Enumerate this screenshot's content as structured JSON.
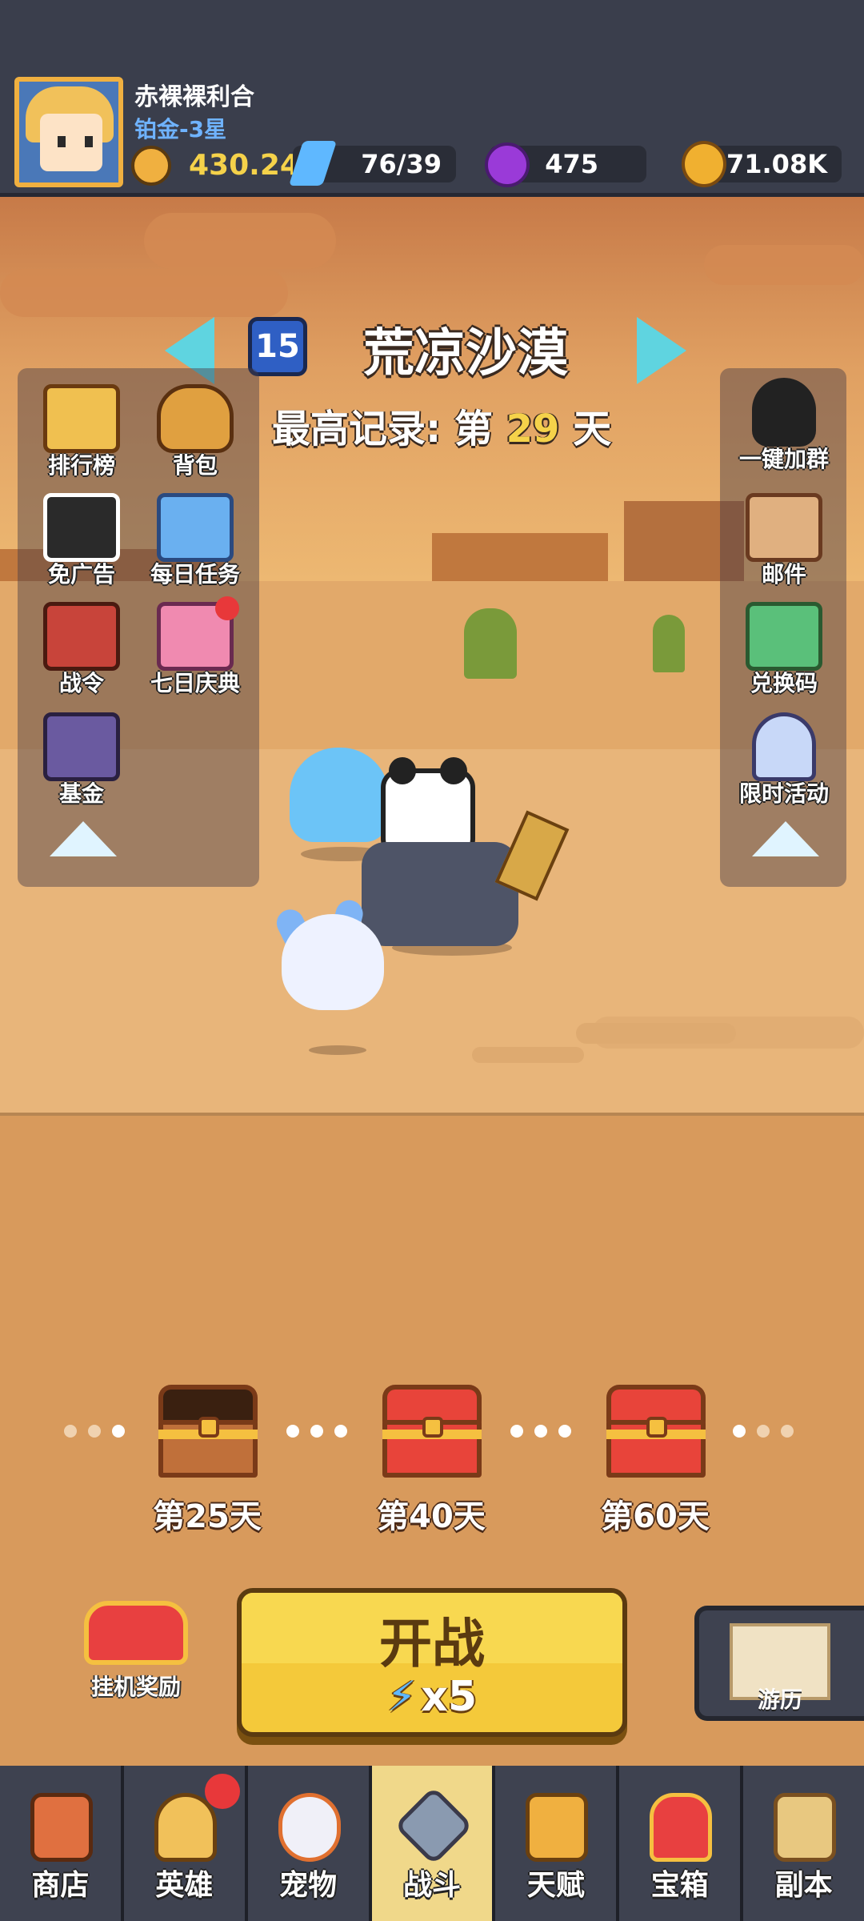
{
  "player": {
    "name": "赤裸裸利合",
    "rank": "铂金-3星"
  },
  "resources": {
    "power": "430.24K",
    "energy": "76/39",
    "gems": "475",
    "gold": "71.08K"
  },
  "level": {
    "number": "15",
    "name": "荒凉沙漠",
    "record_prefix": "最高记录: 第",
    "record_day": "29",
    "record_suffix": "天"
  },
  "left_menu": [
    {
      "label": "排行榜",
      "icon": "leaderboard-scroll-icon"
    },
    {
      "label": "背包",
      "icon": "backpack-icon"
    },
    {
      "label": "免广告",
      "icon": "no-ads-icon"
    },
    {
      "label": "每日任务",
      "icon": "daily-task-icon"
    },
    {
      "label": "战令",
      "icon": "battle-pass-icon"
    },
    {
      "label": "七日庆典",
      "icon": "gift-box-icon"
    },
    {
      "label": "基金",
      "icon": "safe-vault-icon"
    }
  ],
  "right_menu": [
    {
      "label": "一键加群",
      "icon": "penguin-icon"
    },
    {
      "label": "邮件",
      "icon": "mail-scroll-icon"
    },
    {
      "label": "兑换码",
      "icon": "redeem-ticket-icon"
    },
    {
      "label": "限时活动",
      "icon": "gashapon-icon"
    }
  ],
  "milestones": [
    {
      "label": "第25天",
      "state": "opened"
    },
    {
      "label": "第40天",
      "state": "locked"
    },
    {
      "label": "第60天",
      "state": "locked"
    }
  ],
  "actions": {
    "idle_reward": "挂机奖励",
    "battle_title": "开战",
    "battle_cost": "x5",
    "travel": "游历"
  },
  "nav": [
    {
      "label": "商店",
      "icon": "shop-stall-icon"
    },
    {
      "label": "英雄",
      "icon": "hero-icon"
    },
    {
      "label": "宠物",
      "icon": "pet-icon"
    },
    {
      "label": "战斗",
      "icon": "crossed-swords-icon"
    },
    {
      "label": "天赋",
      "icon": "winged-fist-icon"
    },
    {
      "label": "宝箱",
      "icon": "treasure-chest-icon"
    },
    {
      "label": "副本",
      "icon": "map-scroll-icon"
    }
  ],
  "colors": {
    "accent_gold": "#f5d24a",
    "rank_blue": "#6fb3ff",
    "notify_red": "#e8383a",
    "active_tab": "#f0d88a"
  }
}
